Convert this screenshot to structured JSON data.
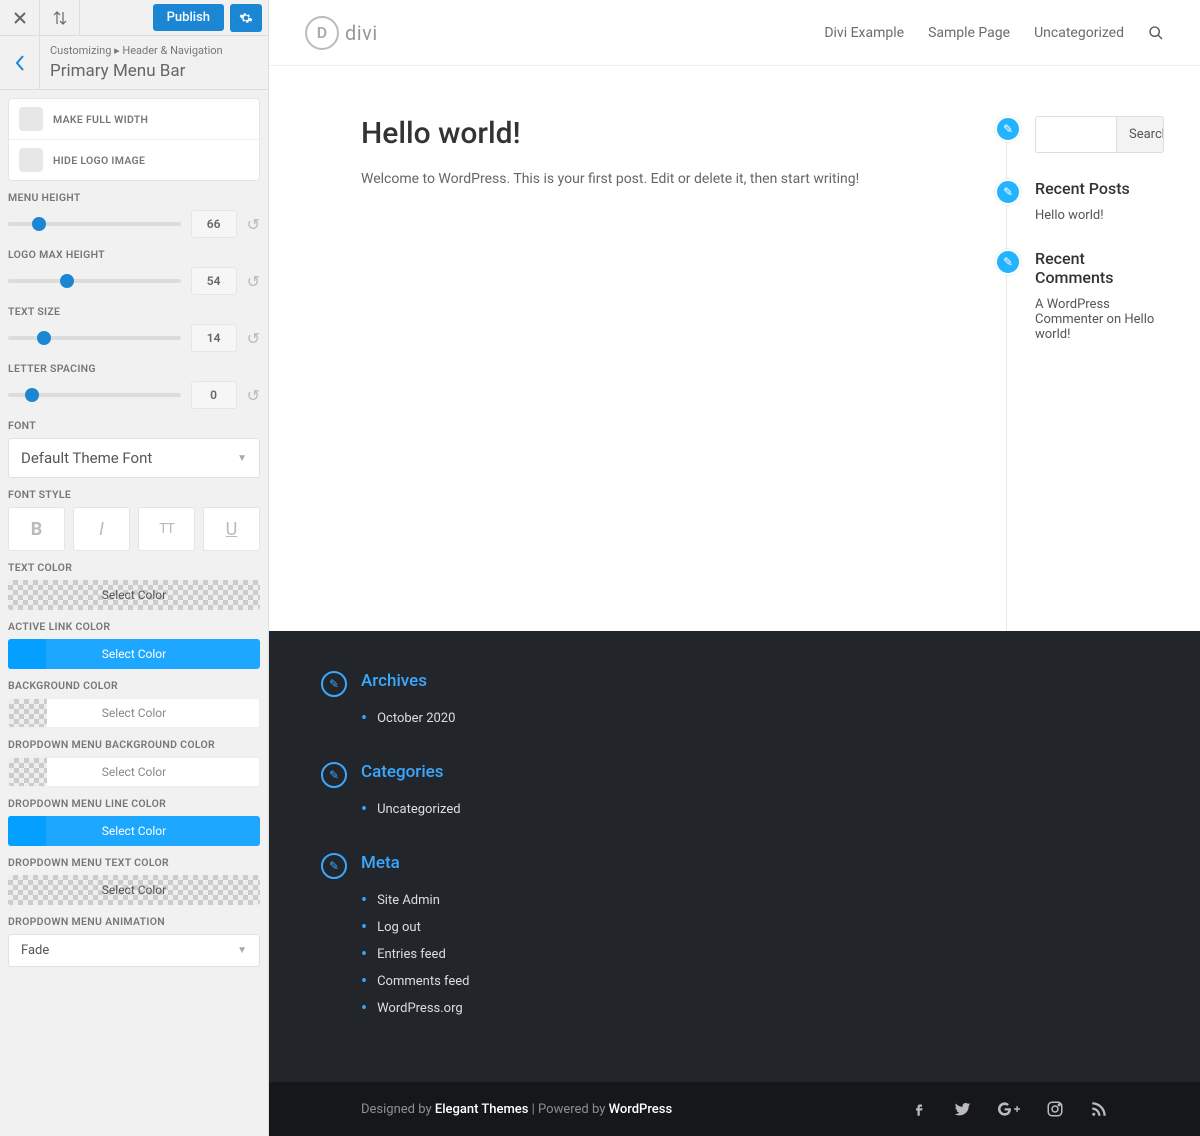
{
  "topbar": {
    "publish_label": "Publish"
  },
  "breadcrumb": {
    "root": "Customizing",
    "section": "Header & Navigation",
    "title": "Primary Menu Bar"
  },
  "toggles": {
    "make_full_width": "MAKE FULL WIDTH",
    "hide_logo": "HIDE LOGO IMAGE"
  },
  "sliders": {
    "menu_height": {
      "label": "MENU HEIGHT",
      "value": "66",
      "pct": 18
    },
    "logo_max_height": {
      "label": "LOGO MAX HEIGHT",
      "value": "54",
      "pct": 34
    },
    "text_size": {
      "label": "TEXT SIZE",
      "value": "14",
      "pct": 21
    },
    "letter_spacing": {
      "label": "LETTER SPACING",
      "value": "0",
      "pct": 14
    }
  },
  "font": {
    "label": "FONT",
    "value": "Default Theme Font",
    "style_label": "FONT STYLE"
  },
  "colors": {
    "text": {
      "label": "TEXT COLOR",
      "btn": "Select Color",
      "sw": "checker"
    },
    "active_link": {
      "label": "ACTIVE LINK COLOR",
      "btn": "Select Color",
      "sw": "#1ea7ff",
      "bg": "#1ea7ff"
    },
    "background": {
      "label": "BACKGROUND COLOR",
      "btn": "Select Color",
      "sw": "checker",
      "whiteBg": true
    },
    "dd_bg": {
      "label": "DROPDOWN MENU BACKGROUND COLOR",
      "btn": "Select Color",
      "sw": "checker",
      "whiteBg": true
    },
    "dd_line": {
      "label": "DROPDOWN MENU LINE COLOR",
      "btn": "Select Color",
      "sw": "#1ea7ff",
      "bg": "#1ea7ff"
    },
    "dd_text": {
      "label": "DROPDOWN MENU TEXT COLOR",
      "btn": "Select Color",
      "sw": "checker"
    }
  },
  "animation": {
    "label": "DROPDOWN MENU ANIMATION",
    "value": "Fade"
  },
  "preview": {
    "logo_text": "divi",
    "nav": [
      "Divi Example",
      "Sample Page",
      "Uncategorized"
    ],
    "post_title": "Hello world!",
    "post_body": "Welcome to WordPress. This is your first post. Edit or delete it, then start writing!",
    "search_btn": "Search",
    "widgets": {
      "recent_posts": {
        "title": "Recent Posts",
        "item": "Hello world!"
      },
      "recent_comments": {
        "title": "Recent Comments",
        "item_author": "A WordPress Commenter",
        "item_on": " on ",
        "item_post": "Hello world!"
      }
    }
  },
  "footer": {
    "archives": {
      "title": "Archives",
      "items": [
        "October 2020"
      ]
    },
    "categories": {
      "title": "Categories",
      "items": [
        "Uncategorized"
      ]
    },
    "meta": {
      "title": "Meta",
      "items": [
        "Site Admin",
        "Log out",
        "Entries feed",
        "Comments feed",
        "WordPress.org"
      ]
    },
    "credit_pre": "Designed by ",
    "credit_theme": "Elegant Themes",
    "credit_mid": " | Powered by ",
    "credit_wp": "WordPress"
  }
}
